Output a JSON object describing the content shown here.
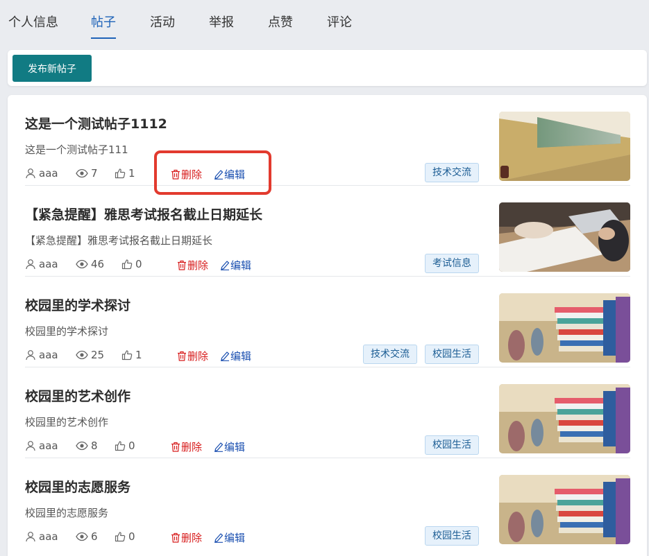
{
  "tabs": [
    "个人信息",
    "帖子",
    "活动",
    "举报",
    "点赞",
    "评论"
  ],
  "active_tab": "帖子",
  "toolbar": {
    "publish_label": "发布新帖子"
  },
  "actions": {
    "delete_label": "删除",
    "edit_label": "编辑"
  },
  "posts": [
    {
      "title": "这是一个测试帖子1112",
      "desc": "这是一个测试帖子111",
      "author": "aaa",
      "views": "7",
      "likes": "1",
      "tags": [
        "技术交流"
      ],
      "image": "corridor-photo"
    },
    {
      "title": "【紧急提醒】雅思考试报名截止日期延长",
      "desc": "【紧急提醒】雅思考试报名截止日期延长",
      "author": "aaa",
      "views": "46",
      "likes": "0",
      "tags": [
        "考试信息"
      ],
      "image": "desk-documents-photo"
    },
    {
      "title": "校园里的学术探讨",
      "desc": "校园里的学术探讨",
      "author": "aaa",
      "views": "25",
      "likes": "1",
      "tags": [
        "技术交流",
        "校园生活"
      ],
      "image": "books-stack-photo"
    },
    {
      "title": "校园里的艺术创作",
      "desc": "校园里的艺术创作",
      "author": "aaa",
      "views": "8",
      "likes": "0",
      "tags": [
        "校园生活"
      ],
      "image": "books-stack-photo"
    },
    {
      "title": "校园里的志愿服务",
      "desc": "校园里的志愿服务",
      "author": "aaa",
      "views": "6",
      "likes": "0",
      "tags": [
        "校园生活"
      ],
      "image": "books-stack-photo"
    }
  ],
  "colors": {
    "accent": "#1f63b8",
    "primary_button": "#117b83",
    "delete": "#d71c1c",
    "edit": "#1a4fb0",
    "highlight_box": "#e23a2e"
  }
}
